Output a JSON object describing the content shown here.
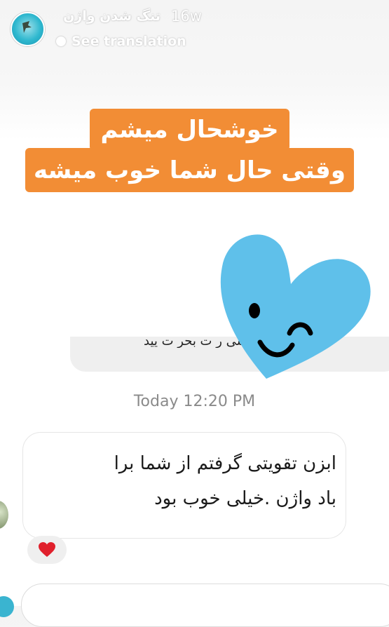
{
  "header": {
    "username": "تنگ شدن واژن",
    "time_ago": "16w",
    "see_translation": "See translation",
    "avatar_icon": "profile-avatar",
    "translate_icon": "translate-dot-icon"
  },
  "sticker": {
    "line1": "خوشحال میشم",
    "line2": "وقتی حال شما خوب میشه",
    "color": "#f28d35"
  },
  "heart_sticker": {
    "icon": "winking-heart-icon",
    "color": "#5fc0ea"
  },
  "chat": {
    "previous_message_partial": "پسی ر ت بحر ت یید",
    "timestamp": "Today 12:20 PM",
    "message_line1": "ابزن تقویتی گرفتم از شما برا",
    "message_line2": "باد واژن .خیلی خوب بود",
    "reaction": "heart-icon",
    "reaction_color": "#e0202c"
  }
}
